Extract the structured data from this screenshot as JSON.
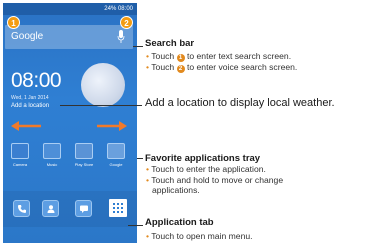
{
  "screen": {
    "status_text": "24% 08:00",
    "search_hint": "Google",
    "badge_1": "1",
    "badge_2": "2",
    "clock": "08:00",
    "date": "Wed, 1 Jan 2014",
    "location": "Add a location",
    "favorite_apps": [
      "Camera",
      "Music",
      "Play Store",
      "Google"
    ],
    "dock_icons": [
      "phone-icon",
      "contacts-icon",
      "messaging-icon",
      "app-drawer-icon"
    ],
    "colors": {
      "screen": "#2f7fd3",
      "arrow": "#f07a2a",
      "badge": "#f39c12"
    }
  },
  "annotations": {
    "search_bar": {
      "title": "Search bar",
      "line1_a": "Touch",
      "line1_num": "1",
      "line1_b": "to enter text search screen.",
      "line2_a": "Touch",
      "line2_num": "2",
      "line2_b": "to enter voice search screen."
    },
    "weather": "Add a location to display local weather.",
    "favorites": {
      "title": "Favorite applications tray",
      "line1": "Touch to enter the application.",
      "line2": "Touch and hold to move or change",
      "line3": "applications."
    },
    "app_tab": {
      "title": "Application tab",
      "line1": "Touch to open main menu."
    },
    "bullet": "•"
  }
}
